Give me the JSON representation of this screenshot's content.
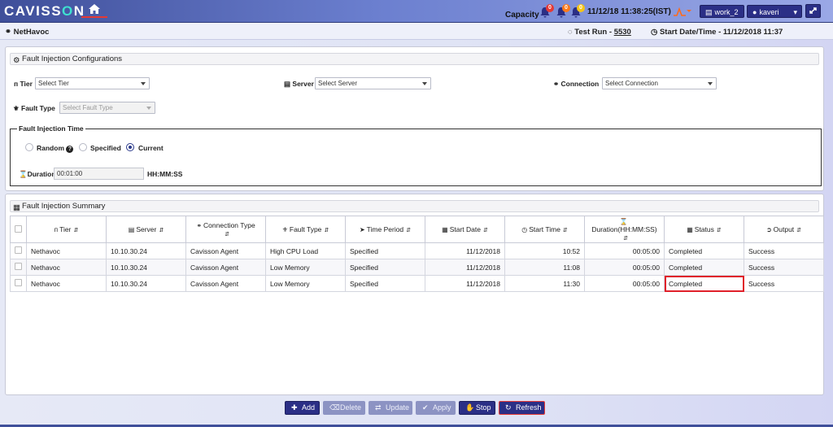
{
  "header": {
    "logo_left": "CAVISS",
    "logo_o": "O",
    "logo_right": "N",
    "capacity_label": "Capacity",
    "bells": [
      {
        "icon": "bell-icon",
        "count": "0",
        "color": "#e53935"
      },
      {
        "icon": "bell-icon",
        "count": "0",
        "color": "#ff7a1a"
      },
      {
        "icon": "bell-icon",
        "count": "0",
        "color": "#f5c518"
      }
    ],
    "datetime": "11/12/18 11:38:25(IST)",
    "workspace_label": "work_2",
    "user_label": "kaveri"
  },
  "subheader": {
    "title": "NetHavoc",
    "test_run_label": "Test Run - ",
    "test_run_value": "5530",
    "start_datetime": "Start Date/Time - 11/12/2018 11:37"
  },
  "config": {
    "panel_title": "Fault Injection Configurations",
    "tier_label": "Tier",
    "tier_placeholder": "Select Tier",
    "server_label": "Server",
    "server_placeholder": "Select Server",
    "connection_label": "Connection",
    "connection_placeholder": "Select Connection",
    "fault_type_label": "Fault Type",
    "fault_type_placeholder": "Select Fault Type",
    "time_legend": "Fault Injection Time",
    "radio_random": "Random",
    "radio_specified": "Specified",
    "radio_current": "Current",
    "selected_time": "Current",
    "duration_label": "Duration",
    "duration_value": "00:01:00",
    "duration_format": "HH:MM:SS"
  },
  "summary": {
    "panel_title": "Fault Injection Summary",
    "columns": [
      "Tier",
      "Server",
      "Connection Type",
      "Fault Type",
      "Time Period",
      "Start Date",
      "Start Time",
      "Duration(HH:MM:SS)",
      "Status",
      "Output"
    ],
    "rows": [
      {
        "tier": "Nethavoc",
        "server": "10.10.30.24",
        "connection_type": "Cavisson Agent",
        "fault_type": "High CPU Load",
        "time_period": "Specified",
        "start_date": "11/12/2018",
        "start_time": "10:52",
        "duration": "00:05:00",
        "status": "Completed",
        "output": "Success"
      },
      {
        "tier": "Nethavoc",
        "server": "10.10.30.24",
        "connection_type": "Cavisson Agent",
        "fault_type": "Low Memory",
        "time_period": "Specified",
        "start_date": "11/12/2018",
        "start_time": "11:08",
        "duration": "00:05:00",
        "status": "Completed",
        "output": "Success"
      },
      {
        "tier": "Nethavoc",
        "server": "10.10.30.24",
        "connection_type": "Cavisson Agent",
        "fault_type": "Low Memory",
        "time_period": "Specified",
        "start_date": "11/12/2018",
        "start_time": "11:30",
        "duration": "00:05:00",
        "status": "Completed",
        "output": "Success"
      }
    ]
  },
  "actions": {
    "add": "Add",
    "delete": "Delete",
    "update": "Update",
    "apply": "Apply",
    "stop": "Stop",
    "refresh": "Refresh"
  },
  "colors": {
    "primary": "#2b2f86",
    "status_completed": "#1aa21a",
    "highlight": "#e0202a"
  }
}
